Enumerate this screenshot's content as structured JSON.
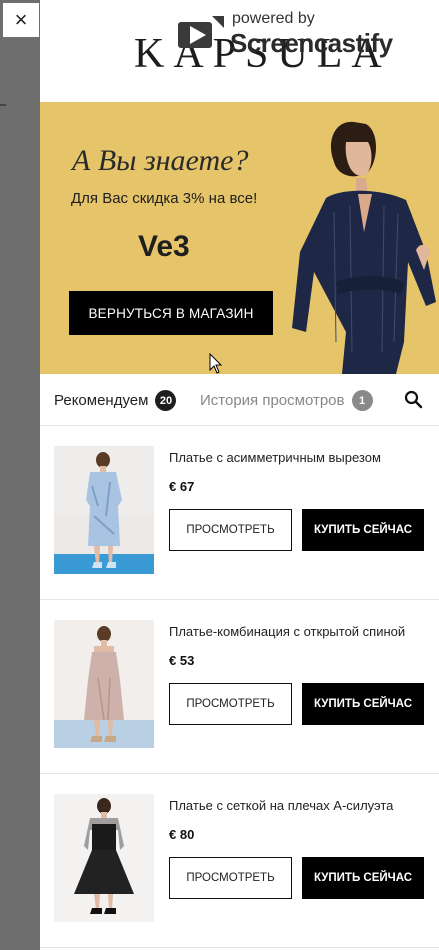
{
  "close_label": "×",
  "header": {
    "logo": "KAPSULA"
  },
  "watermark": {
    "powered": "powered by",
    "brand": "Screencastify"
  },
  "banner": {
    "title": "А Вы знаете?",
    "subtitle": "Для Вас скидка 3% на все!",
    "code": "Ve3",
    "button": "ВЕРНУТЬСЯ В МАГАЗИН"
  },
  "tabs": {
    "recommended": {
      "label": "Рекомендуем",
      "count": "20"
    },
    "history": {
      "label": "История просмотров",
      "count": "1"
    }
  },
  "products": [
    {
      "name": "Платье с асимметричным вырезом",
      "price": "€ 67",
      "view": "ПРОСМОТРЕТЬ",
      "buy": "КУПИТЬ СЕЙЧАС"
    },
    {
      "name": "Платье-комбинация с открытой спиной",
      "price": "€ 53",
      "view": "ПРОСМОТРЕТЬ",
      "buy": "КУПИТЬ СЕЙЧАС"
    },
    {
      "name": "Платье с сеткой на плечах А-силуэта",
      "price": "€ 80",
      "view": "ПРОСМОТРЕТЬ",
      "buy": "КУПИТЬ СЕЙЧАС"
    }
  ],
  "colors": {
    "banner_bg": "#e6c46a",
    "accent": "#000000",
    "backdrop": "#6e6e6e"
  },
  "icons": [
    "close-icon",
    "search-icon",
    "cursor-icon",
    "screencastify-logo-icon"
  ]
}
